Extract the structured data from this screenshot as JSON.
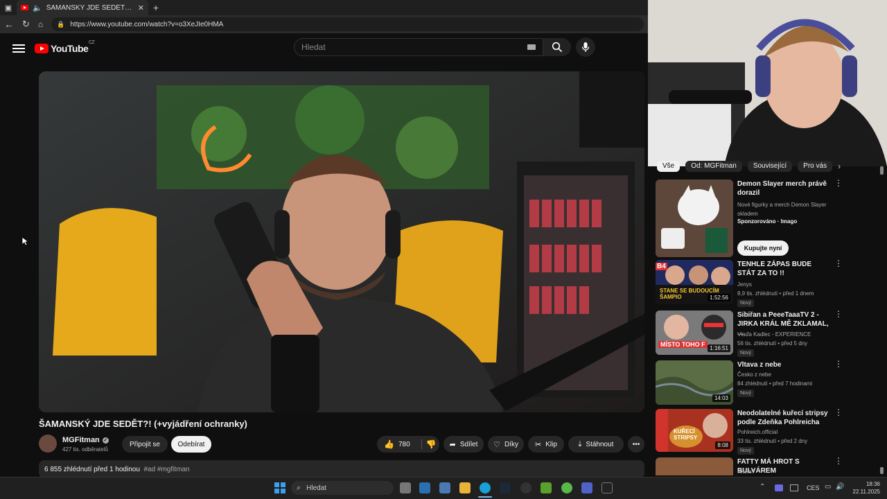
{
  "browser": {
    "tab_title": "ŠAMANSKÝ JDE SEDĚT?! (+vyj",
    "url": "https://www.youtube.com/watch?v=o3XeJIe0HMA"
  },
  "header": {
    "logo_text": "YouTube",
    "region": "CZ",
    "search_placeholder": "Hledat"
  },
  "video": {
    "title": "ŠAMANSKÝ JDE SEDĚT?! (+vyjádření ochranky)",
    "channel": "MGFitman",
    "subscribers": "427 tis. odběratelů",
    "join_label": "Připojit se",
    "subscribe_label": "Odebírat",
    "likes": "780",
    "share_label": "Sdílet",
    "thanks_label": "Díky",
    "clip_label": "Klip",
    "download_label": "Stáhnout",
    "views_date": "6 855 zhlédnutí  před 1 hodinou",
    "tags": "#ad #mgfitman"
  },
  "sidebar": {
    "chips": [
      "Vše",
      "Od: MGFitman",
      "Související",
      "Pro vás"
    ],
    "items": [
      {
        "title": "Demon Slayer merch právě dorazil",
        "meta1": "Nové figurky a merch Demon Slayer skladem",
        "meta2": "Sponzorováno · Imago",
        "cta": "Kupujte nyní"
      },
      {
        "title": "TENHLE ZÁPAS BUDE STÁT ZA TO !!",
        "meta1": "Jenys",
        "meta2": "8,9 tis. zhlédnutí • před 1 dnem",
        "badge": "Nový",
        "duration": "1:52:56",
        "thumb_text": "STANE SE BUDOUCÍM ŠAMPIO"
      },
      {
        "title": "Sibiřan a PeeeTaaaTV 2 - JIRKA KRÁL MĚ ZKLAMAL, ...",
        "meta1": "Vlaďa Kadlec - EXPERIENCE",
        "meta2": "56 tis. zhlédnutí • před 5 dny",
        "badge": "Nový",
        "duration": "1:16:51",
        "thumb_text": "MÍSTO TOHO F"
      },
      {
        "title": "Vltava z nebe",
        "meta1": "Česko z nebe",
        "meta2": "84 zhlédnutí • před 7 hodinami",
        "badge": "Nový",
        "duration": "14:03"
      },
      {
        "title": "Neodolatelné kuřecí stripsy podle Zdeňka Pohlreicha",
        "meta1": "Pohlreich.official",
        "meta2": "33 tis. zhlédnutí • před 2 dny",
        "badge": "Nový",
        "duration": "8:08",
        "thumb_text": "KUŘECÍ STRIPSY"
      },
      {
        "title": "FATTY MÁ HROT S BULVÁREM",
        "meta1": "HaiseT"
      }
    ]
  },
  "taskbar": {
    "search_placeholder": "Hledat",
    "language": "CES",
    "time": "18:36",
    "date": "22.11.2025"
  },
  "colors": {
    "youtube_red": "#ff0000",
    "background": "#0f0f0f",
    "chip": "#272727"
  }
}
